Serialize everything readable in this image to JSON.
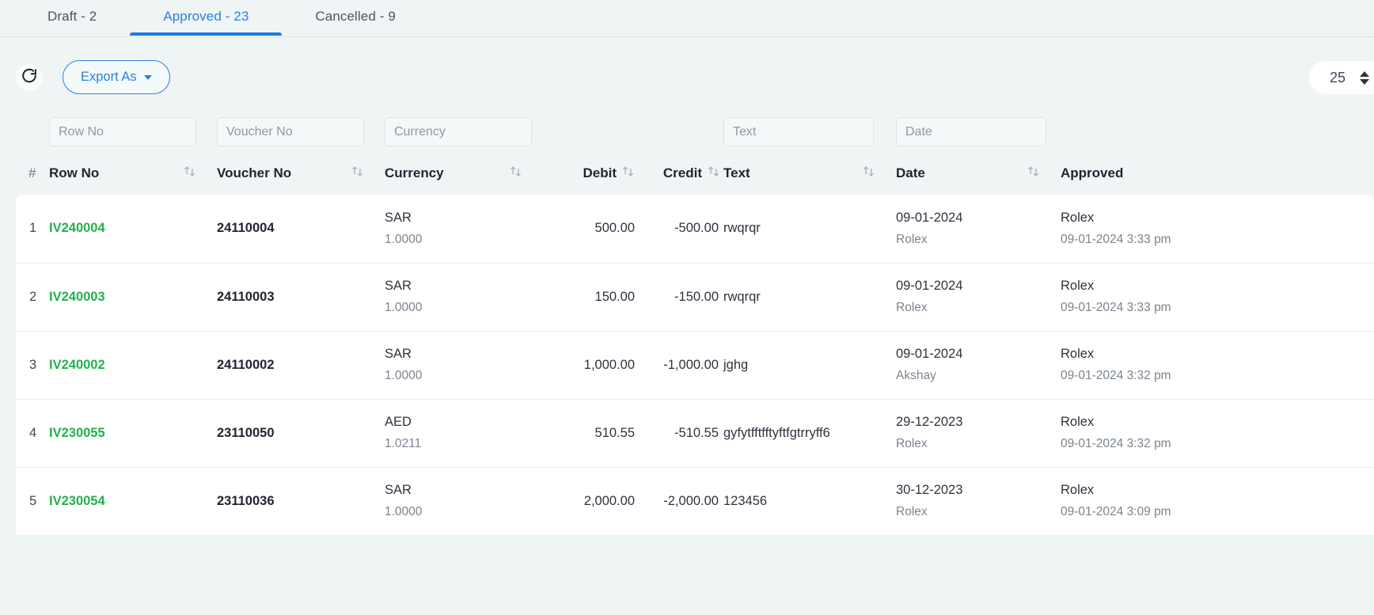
{
  "theme": {
    "accent": "#1d7ae8",
    "link_green": "#22b14c",
    "page_bg": "#eff4f4"
  },
  "tabs": [
    {
      "label": "Draft - 2",
      "active": false
    },
    {
      "label": "Approved - 23",
      "active": true
    },
    {
      "label": "Cancelled - 9",
      "active": false
    }
  ],
  "toolbar": {
    "refresh_icon": "refresh-icon",
    "export_label": "Export As",
    "export_caret_icon": "caret-down-icon",
    "page_size_value": "25",
    "page_size_spinner_icon": "up-down-spinner-icon"
  },
  "filters": [
    {
      "name": "row-no",
      "placeholder": "Row No",
      "value": ""
    },
    {
      "name": "voucher-no",
      "placeholder": "Voucher No",
      "value": ""
    },
    {
      "name": "currency",
      "placeholder": "Currency",
      "value": ""
    },
    {
      "name": "text",
      "placeholder": "Text",
      "value": ""
    },
    {
      "name": "date",
      "placeholder": "Date",
      "value": ""
    }
  ],
  "columns": {
    "index": "#",
    "row_no": "Row No",
    "voucher_no": "Voucher No",
    "currency": "Currency",
    "debit": "Debit",
    "credit": "Credit",
    "text": "Text",
    "date": "Date",
    "approved": "Approved"
  },
  "sort_icon": "sort-updown-icon",
  "rows": [
    {
      "index": "1",
      "row_no": "IV240004",
      "voucher_no": "24110004",
      "currency": "SAR",
      "rate": "1.0000",
      "debit": "500.00",
      "credit": "-500.00",
      "text": "rwqrqr",
      "date": "09-01-2024",
      "date_sub": "Rolex",
      "approved_by": "Rolex",
      "approved_at": "09-01-2024 3:33 pm"
    },
    {
      "index": "2",
      "row_no": "IV240003",
      "voucher_no": "24110003",
      "currency": "SAR",
      "rate": "1.0000",
      "debit": "150.00",
      "credit": "-150.00",
      "text": "rwqrqr",
      "date": "09-01-2024",
      "date_sub": "Rolex",
      "approved_by": "Rolex",
      "approved_at": "09-01-2024 3:33 pm"
    },
    {
      "index": "3",
      "row_no": "IV240002",
      "voucher_no": "24110002",
      "currency": "SAR",
      "rate": "1.0000",
      "debit": "1,000.00",
      "credit": "-1,000.00",
      "text": "jghg",
      "date": "09-01-2024",
      "date_sub": "Akshay",
      "approved_by": "Rolex",
      "approved_at": "09-01-2024 3:32 pm"
    },
    {
      "index": "4",
      "row_no": "IV230055",
      "voucher_no": "23110050",
      "currency": "AED",
      "rate": "1.0211",
      "debit": "510.55",
      "credit": "-510.55",
      "text": "gyfytfftfftyftfgtrryff6",
      "date": "29-12-2023",
      "date_sub": "Rolex",
      "approved_by": "Rolex",
      "approved_at": "09-01-2024 3:32 pm"
    },
    {
      "index": "5",
      "row_no": "IV230054",
      "voucher_no": "23110036",
      "currency": "SAR",
      "rate": "1.0000",
      "debit": "2,000.00",
      "credit": "-2,000.00",
      "text": "123456",
      "date": "30-12-2023",
      "date_sub": "Rolex",
      "approved_by": "Rolex",
      "approved_at": "09-01-2024 3:09 pm"
    }
  ]
}
